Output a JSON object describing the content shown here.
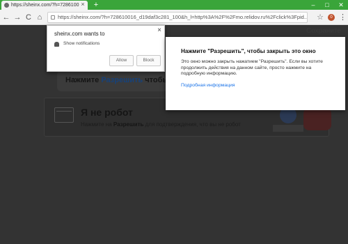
{
  "browser": {
    "tab_title": "https://sheinx.com/?h=7286100",
    "new_tab": "+",
    "window_controls": [
      "–",
      "□",
      "✕"
    ],
    "nav": {
      "back": "←",
      "forward": "→",
      "reload": "C",
      "home": "⌂"
    },
    "url_host": "sheinx.com",
    "url_full": "https://sheinx.com/?h=728610016_d19daf3c281_100&h_l=http%3A%2F%2Fmo.relidov.ru%2Fclick%3Fpid...",
    "ext_badge": "0"
  },
  "notification_prompt": {
    "site_wants": "sheinx.com wants to",
    "permission": "Show notifications",
    "allow_label": "Allow",
    "block_label": "Block",
    "close": "×"
  },
  "info_box": {
    "heading": "Нажмите \"Разрешить\", чтобы закрыть это окно",
    "body": "Это окно можно закрыть нажатием \"Разрешить\". Если вы хотите продолжить действия на данном сайте, просто нажмите на подробную информацию.",
    "link": "Подробная информация"
  },
  "page": {
    "faint_top": "Сохраните",
    "banner_prefix": "Нажмите ",
    "banner_highlight": "Разрешить",
    "banner_suffix": " чтобы",
    "captcha_title": "Я не робот",
    "captcha_sub_prefix": "Нажмите на ",
    "captcha_sub_bold": "Разрешить",
    "captcha_sub_suffix": " для подтверждения, что вы не робот"
  }
}
